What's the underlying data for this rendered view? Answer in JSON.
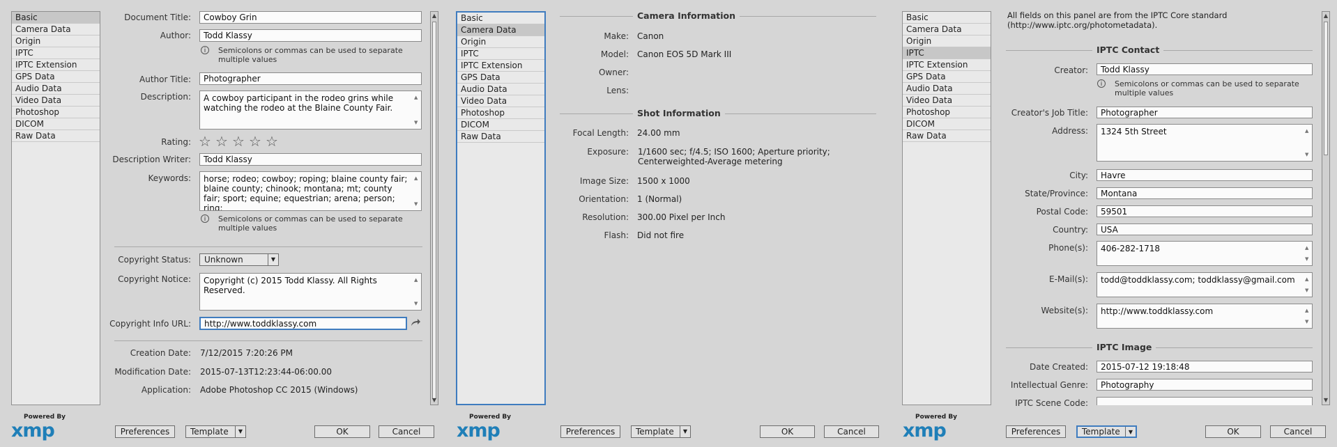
{
  "panels": [
    {
      "nav": [
        "Basic",
        "Camera Data",
        "Origin",
        "IPTC",
        "IPTC Extension",
        "GPS Data",
        "Audio Data",
        "Video Data",
        "Photoshop",
        "DICOM",
        "Raw Data"
      ],
      "selected": 0
    },
    {
      "nav": [
        "Basic",
        "Camera Data",
        "Origin",
        "IPTC",
        "IPTC Extension",
        "GPS Data",
        "Audio Data",
        "Video Data",
        "Photoshop",
        "DICOM",
        "Raw Data"
      ],
      "selected": 1
    },
    {
      "nav": [
        "Basic",
        "Camera Data",
        "Origin",
        "IPTC",
        "IPTC Extension",
        "GPS Data",
        "Audio Data",
        "Video Data",
        "Photoshop",
        "DICOM",
        "Raw Data"
      ],
      "selected": 3
    }
  ],
  "basic": {
    "doc_title_label": "Document Title:",
    "doc_title": "Cowboy Grin",
    "author_label": "Author:",
    "author": "Todd Klassy",
    "separator_hint": "Semicolons or commas can be used to separate multiple values",
    "author_title_label": "Author Title:",
    "author_title": "Photographer",
    "description_label": "Description:",
    "description": "A cowboy participant in the rodeo grins while watching the rodeo at the Blaine County Fair.",
    "rating_label": "Rating:",
    "rating": 0,
    "desc_writer_label": "Description Writer:",
    "desc_writer": "Todd Klassy",
    "keywords_label": "Keywords:",
    "keywords": "horse; rodeo; cowboy; roping; blaine county fair; blaine county; chinook; montana; mt; county fair; sport; equine; equestrian; arena; person; ring;",
    "copyright_status_label": "Copyright Status:",
    "copyright_status": "Unknown",
    "copyright_notice_label": "Copyright Notice:",
    "copyright_notice": "Copyright (c) 2015 Todd Klassy. All Rights Reserved.",
    "copyright_url_label": "Copyright Info URL:",
    "copyright_url": "http://www.toddklassy.com",
    "creation_date_label": "Creation Date:",
    "creation_date": "7/12/2015 7:20:26 PM",
    "mod_date_label": "Modification Date:",
    "mod_date": "2015-07-13T12:23:44-06:00.00",
    "application_label": "Application:",
    "application": "Adobe Photoshop CC 2015 (Windows)"
  },
  "camera": {
    "camera_info_title": "Camera Information",
    "make_label": "Make:",
    "make": "Canon",
    "model_label": "Model:",
    "model": "Canon EOS 5D Mark III",
    "owner_label": "Owner:",
    "owner": "",
    "lens_label": "Lens:",
    "lens": "",
    "shot_info_title": "Shot Information",
    "focal_label": "Focal Length:",
    "focal": "24.00 mm",
    "exposure_label": "Exposure:",
    "exposure_line1": "1/1600 sec;   f/4.5;   ISO 1600;   Aperture priority;",
    "exposure_line2": "Centerweighted-Average metering",
    "size_label": "Image Size:",
    "size": "1500 x 1000",
    "orientation_label": "Orientation:",
    "orientation": "1 (Normal)",
    "resolution_label": "Resolution:",
    "resolution": "300.00 Pixel per Inch",
    "flash_label": "Flash:",
    "flash": "Did not fire"
  },
  "iptc": {
    "note_line1": "All fields on this panel are from the IPTC Core standard",
    "note_line2": "(http://www.iptc.org/photometadata).",
    "contact_title": "IPTC Contact",
    "creator_label": "Creator:",
    "creator": "Todd Klassy",
    "separator_hint": "Semicolons or commas can be used to separate multiple values",
    "job_title_label": "Creator's Job Title:",
    "job_title": "Photographer",
    "address_label": "Address:",
    "address": "1324 5th Street",
    "city_label": "City:",
    "city": "Havre",
    "state_label": "State/Province:",
    "state": "Montana",
    "postal_label": "Postal Code:",
    "postal": "59501",
    "country_label": "Country:",
    "country": "USA",
    "phone_label": "Phone(s):",
    "phone": "406-282-1718",
    "email_label": "E-Mail(s):",
    "email": "todd@toddklassy.com; toddklassy@gmail.com",
    "website_label": "Website(s):",
    "website": "http://www.toddklassy.com",
    "image_title": "IPTC Image",
    "date_created_label": "Date Created:",
    "date_created": "2015-07-12 19:18:48",
    "genre_label": "Intellectual Genre:",
    "genre": "Photography",
    "scene_label": "IPTC Scene Code:",
    "scene": ""
  },
  "footer": {
    "powered_by": "Powered By",
    "xmp": "xmp",
    "preferences": "Preferences",
    "template": "Template",
    "ok": "OK",
    "cancel": "Cancel"
  }
}
